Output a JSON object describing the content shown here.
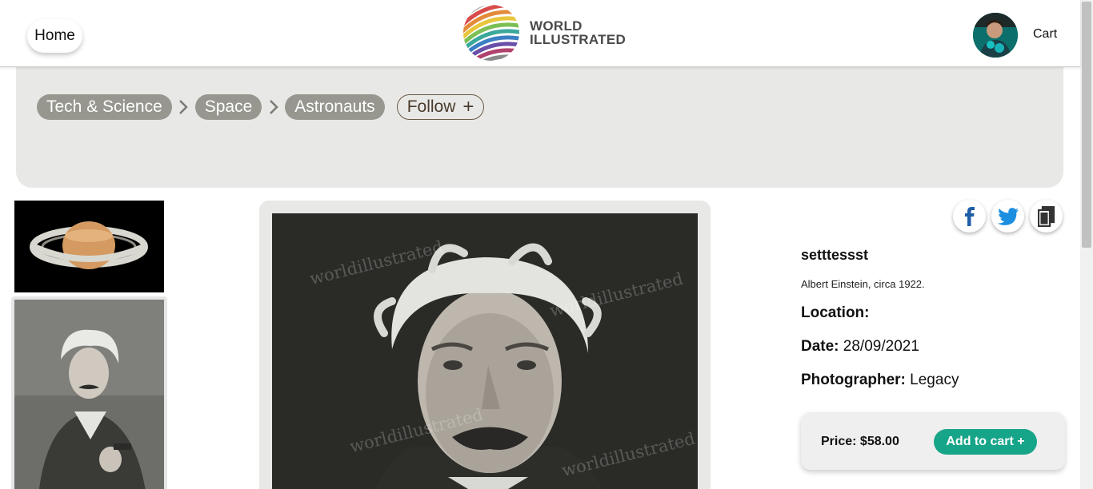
{
  "header": {
    "home_label": "Home",
    "logo_line1": "WORLD",
    "logo_line2": "ILLUSTRATED",
    "cart_label": "Cart"
  },
  "breadcrumb": {
    "items": [
      {
        "label": "Tech & Science"
      },
      {
        "label": "Space"
      },
      {
        "label": "Astronauts"
      }
    ],
    "follow_label": "Follow",
    "follow_icon": "+"
  },
  "image": {
    "watermark": "worldillustrated",
    "title": "setttessst",
    "caption": "Albert Einstein, circa 1922.",
    "location_label": "Location:",
    "location_value": "",
    "date_label": "Date:",
    "date_value": "28/09/2021",
    "photographer_label": "Photographer:",
    "photographer_value": "Legacy"
  },
  "share": {
    "facebook_icon": "facebook-icon",
    "twitter_icon": "twitter-icon",
    "copy_icon": "copy-icon"
  },
  "purchase": {
    "price_text": "Price: $58.00",
    "add_to_cart_label": "Add to cart +"
  },
  "colors": {
    "chip": "#97978f",
    "accent_green": "#17a589",
    "panel": "#e8e8e6",
    "facebook": "#1877f2",
    "twitter": "#1d9bf0"
  }
}
